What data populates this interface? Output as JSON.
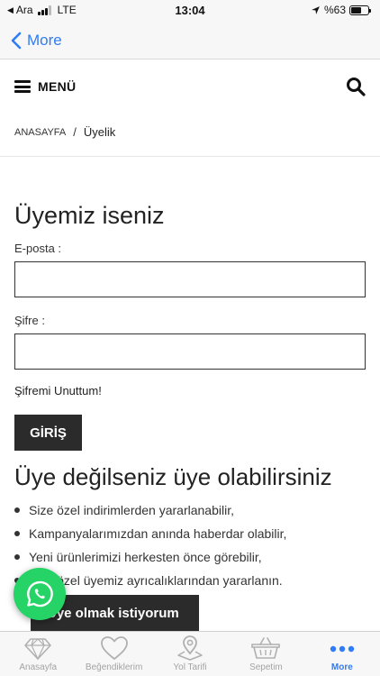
{
  "status_bar": {
    "carrier_back": "Ara",
    "network": "LTE",
    "time": "13:04",
    "battery": "%63",
    "battery_level": 0.63
  },
  "nav": {
    "back_label": "More"
  },
  "header": {
    "menu_label": "MENÜ"
  },
  "breadcrumb": {
    "home": "ANASAYFA",
    "separator": "/",
    "current": "Üyelik"
  },
  "login": {
    "title": "Üyemiz iseniz",
    "email_label": "E-posta :",
    "email_value": "",
    "password_label": "Şifre :",
    "password_value": "",
    "forgot_label": "Şifremi Unuttum!",
    "submit_label": "GİRİŞ"
  },
  "register": {
    "title": "Üye değilseniz üye olabilirsiniz",
    "benefits": [
      "Size özel indirimlerden yararlanabilir,",
      "Kampanyalarımızdan anında haberdar olabilir,",
      "Yeni ürünlerimizi herkesten önce görebilir,",
      "Size özel üyemiz ayrıcalıklarından yararlanın."
    ],
    "button_label": "Üye olmak istiyorum"
  },
  "tab_bar": {
    "items": [
      {
        "label": "Anasayfa",
        "icon": "diamond-icon"
      },
      {
        "label": "Beğendiklerim",
        "icon": "heart-icon"
      },
      {
        "label": "Yol Tarifi",
        "icon": "map-pin-icon"
      },
      {
        "label": "Sepetim",
        "icon": "basket-icon"
      },
      {
        "label": "More",
        "icon": "more-dots-icon"
      }
    ],
    "active_index": 4
  },
  "colors": {
    "accent": "#2f7cf6",
    "button_dark": "#2b2b2b",
    "whatsapp_green": "#25d366"
  }
}
